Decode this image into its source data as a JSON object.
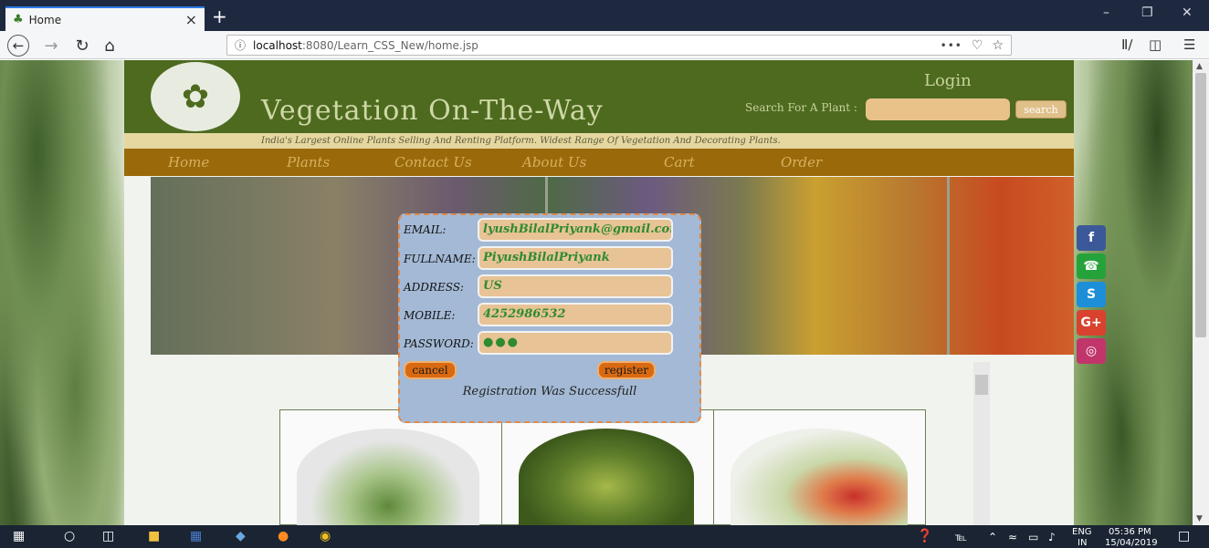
{
  "browser": {
    "tab_title": "Home",
    "tab_icon": "plant-icon",
    "new_tab": "+",
    "url_host": "localhost",
    "url_path": ":8080/Learn_CSS_New/home.jsp",
    "url_menu": "•••",
    "win_min": "–",
    "win_restore": "❐",
    "win_close": "✕"
  },
  "site": {
    "name": "Vegetation On-The-Way",
    "login": "Login",
    "search_label": "Search For A Plant :",
    "search_button": "search",
    "tagline": "India's Largest Online Plants Selling And Renting Platform. Widest Range Of Vegetation And Decorating Plants.",
    "menu": [
      "Home",
      "Plants",
      "Contact Us",
      "About Us",
      "Cart",
      "Order"
    ]
  },
  "social": [
    {
      "name": "facebook-icon",
      "glyph": "f",
      "color": "#3b5998"
    },
    {
      "name": "whatsapp-icon",
      "glyph": "☎",
      "color": "#25a33a"
    },
    {
      "name": "skype-icon",
      "glyph": "S",
      "color": "#1d8fd8"
    },
    {
      "name": "googleplus-icon",
      "glyph": "G+",
      "color": "#d8422e"
    },
    {
      "name": "instagram-icon",
      "glyph": "◎",
      "color": "#c1356b"
    }
  ],
  "form": {
    "email_label": "EMAIL:",
    "email_value": "lyushBilalPriyank@gmail.com",
    "fullname_label": "FULLNAME:",
    "fullname_value": "PiyushBilalPriyank",
    "address_label": "ADDRESS:",
    "address_value": "US",
    "mobile_label": "MOBILE:",
    "mobile_value": "4252986532",
    "password_label": "PASSWORD:",
    "password_value": "●●●",
    "cancel_label": "cancel",
    "register_label": "register",
    "message": "Registration Was Successfull"
  },
  "taskbar": {
    "lang": "ENG",
    "region": "IN",
    "time": "05:36 PM",
    "date": "15/04/2019"
  },
  "colors": {
    "header": "#4d6a1f",
    "menubar": "#9a6a0a",
    "modal": "#a3b9d5",
    "input": "#e8c395",
    "button": "#d96a12"
  }
}
